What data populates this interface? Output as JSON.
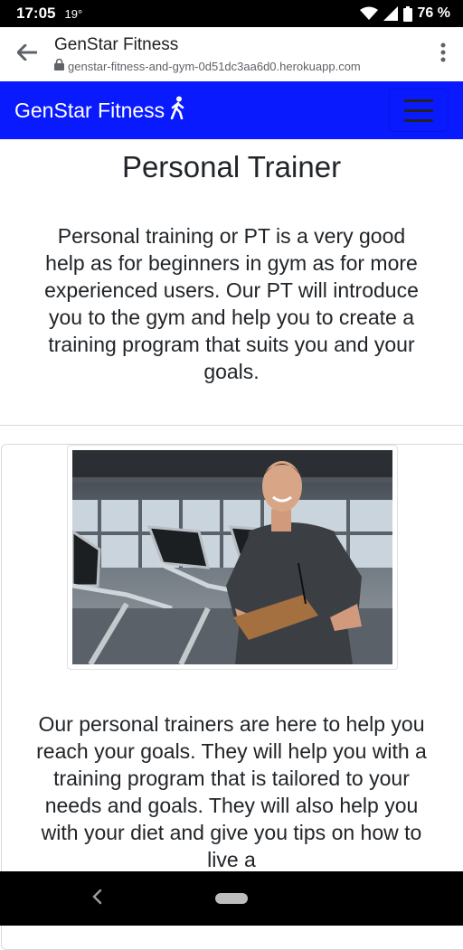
{
  "status_bar": {
    "time": "17:05",
    "temperature": "19°",
    "battery": "76 %"
  },
  "browser": {
    "title": "GenStar Fitness",
    "url": "genstar-fitness-and-gym-0d51dc3aa6d0.herokuapp.com"
  },
  "navbar": {
    "brand": "GenStar Fitness",
    "brand_color": "#0a1aff"
  },
  "page": {
    "title": "Personal Trainer",
    "intro": "Personal training or PT is a very good help as for beginners in gym as for more experienced users. Our PT will introduce you to the gym and help you to create a training program that suits you and your goals.",
    "body": "Our personal trainers are here to help you reach your goals. They will help you with a training program that is tailored to your needs and goals. They will also help you with your diet and give you tips on how to live a"
  },
  "icons": {
    "back": "arrow-left-icon",
    "lock": "lock-icon",
    "menu": "more-vert-icon",
    "brand": "person-walking-icon",
    "toggler": "hamburger-icon"
  }
}
